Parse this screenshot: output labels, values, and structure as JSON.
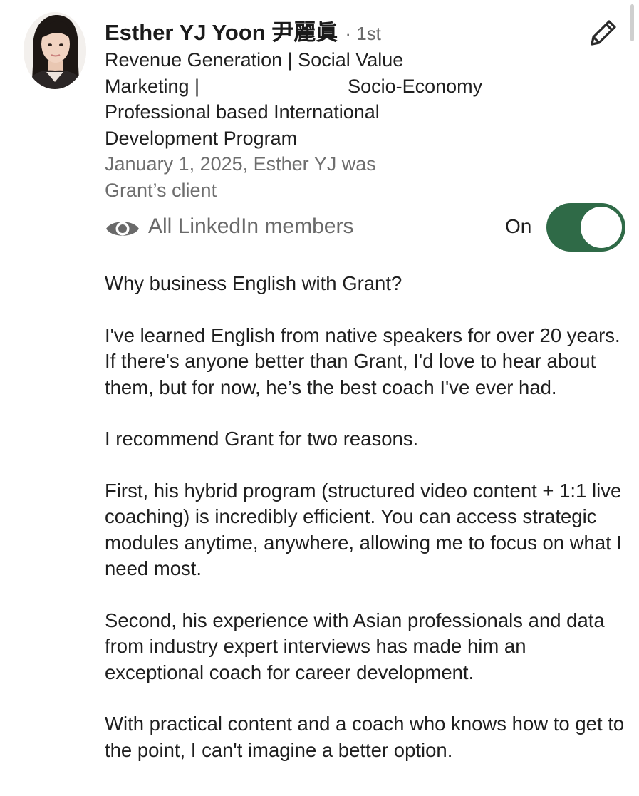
{
  "profile": {
    "name": "Esther YJ Yoon 尹麗眞",
    "degree": "· 1st",
    "headline_lines": [
      "Revenue Generation | Social Value",
      "Marketing |",
      "Socio-Economy",
      "Professional based International",
      "Development Program"
    ],
    "meta_lines": [
      "January 1, 2025, Esther YJ was",
      "Grant’s client"
    ]
  },
  "visibility": {
    "icon": "eye-icon",
    "label": "All LinkedIn members",
    "toggle_state": "On"
  },
  "recommendation": {
    "paragraphs": [
      "Why business English with Grant?",
      "I've learned English from native speakers for over 20 years. If there's anyone better than Grant, I'd love to hear about them, but for now, he’s the best coach I've ever had.",
      "I recommend Grant for two reasons.",
      "First, his hybrid program (structured video content + 1:1 live coaching) is incredibly efficient. You can access strategic modules anytime, anywhere, allowing me to focus on what I need most.",
      "Second, his experience with Asian professionals and data from industry expert interviews has made him an exceptional coach for career development.",
      "With practical content and a coach who knows how to get to the point, I can't imagine a better option."
    ]
  },
  "colors": {
    "toggle_on": "#2f6a47",
    "secondary_text": "#6e6e6e",
    "primary_text": "#1f1f1f"
  },
  "icons": {
    "edit": "pencil-icon",
    "avatar": "avatar"
  }
}
